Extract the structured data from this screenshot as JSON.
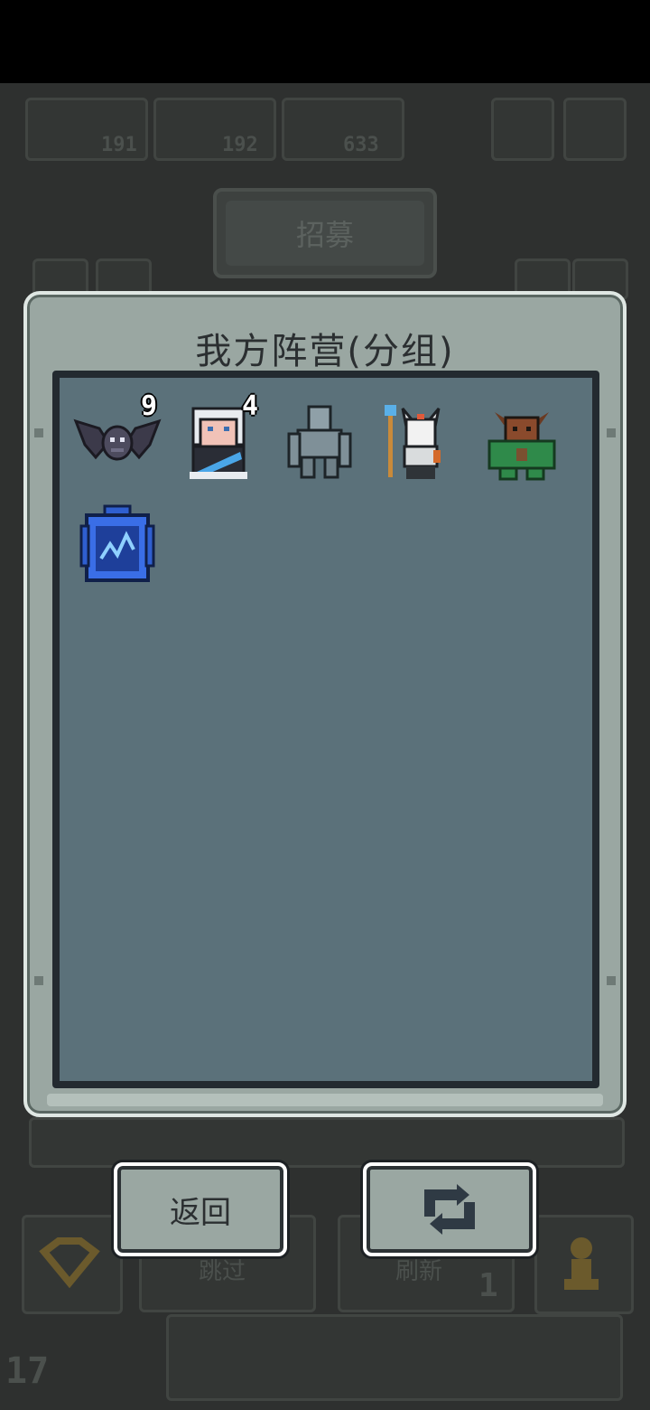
{
  "background": {
    "resources": [
      {
        "icon": "shovel-icon",
        "value": "191"
      },
      {
        "icon": "hammer-icon",
        "value": "192"
      },
      {
        "icon": "scroll-icon",
        "value": "633"
      }
    ],
    "recruit_label": "招募",
    "bottom_labels": [
      "跳过",
      "刷新"
    ],
    "refresh_count": "1",
    "corner_number": "17"
  },
  "panel": {
    "title": "我方阵营(分组)",
    "units": [
      {
        "name": "bat",
        "count": "9"
      },
      {
        "name": "white-haired-mage",
        "count": "4"
      },
      {
        "name": "stone-golem",
        "count": ""
      },
      {
        "name": "bone-shaman",
        "count": ""
      },
      {
        "name": "forest-minotaur",
        "count": ""
      },
      {
        "name": "blue-rune-chest",
        "count": ""
      }
    ]
  },
  "buttons": {
    "back_label": "返回",
    "swap_icon": "swap-arrows-icon"
  },
  "colors": {
    "panel": "#9aa7a2",
    "inner": "#5b717a",
    "border": "#dfe7e3"
  }
}
